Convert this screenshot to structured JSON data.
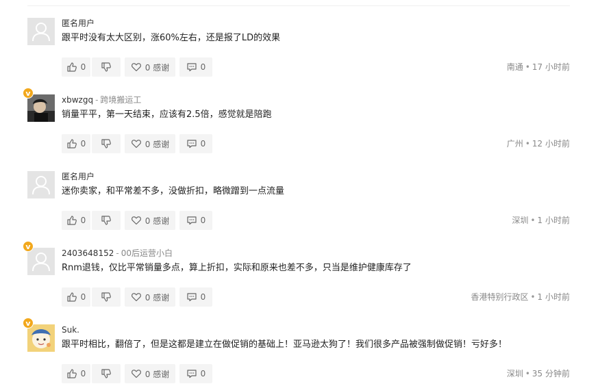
{
  "comments": [
    {
      "username": "匿名用户",
      "tag": "",
      "text": "跟平时没有太大区别，涨60%左右，还是报了LD的效果",
      "avatar": "default-avatar",
      "badge": "",
      "likes": "0",
      "thanks": "0 感谢",
      "replies": "0",
      "location": "南通",
      "time": "17 小时前"
    },
    {
      "username": "xbwzgq",
      "tag": "跨境搬运工",
      "text": "销量平平，第一天结束，应该有2.5倍，感觉就是陪跑",
      "avatar": "photo-avatar",
      "badge": "v",
      "likes": "0",
      "thanks": "0 感谢",
      "replies": "0",
      "location": "广州",
      "time": "12 小时前"
    },
    {
      "username": "匿名用户",
      "tag": "",
      "text": "迷你卖家，和平常差不多，没做折扣，略微蹭到一点流量",
      "avatar": "default-avatar",
      "badge": "",
      "likes": "0",
      "thanks": "0 感谢",
      "replies": "0",
      "location": "深圳",
      "time": "1 小时前"
    },
    {
      "username": "2403648152",
      "tag": "00后运营小白",
      "text": "Rnm退钱，仅比平常销量多点，算上折扣，实际和原来也差不多，只当是维护健康库存了",
      "avatar": "default-avatar",
      "badge": "v",
      "likes": "0",
      "thanks": "0 感谢",
      "replies": "0",
      "location": "香港特别行政区",
      "time": "1 小时前"
    },
    {
      "username": "Suk.",
      "tag": "",
      "text": "跟平时相比，翻倍了，但是这都是建立在做促销的基础上！亚马逊太狗了！我们很多产品被强制做促销！亏好多！",
      "avatar": "cartoon-avatar",
      "badge": "v",
      "likes": "0",
      "thanks": "0 感谢",
      "replies": "0",
      "location": "深圳",
      "time": "35 分钟前"
    }
  ],
  "icons": {
    "like": "thumbs-up-icon",
    "dislike": "thumbs-down-icon",
    "thanks": "heart-icon",
    "reply": "comment-bubble-icon"
  },
  "colors": {
    "badge": "#f2a81d",
    "button_bg": "#f4f4f4",
    "meta_text": "#888888",
    "separator": "#efefef"
  }
}
